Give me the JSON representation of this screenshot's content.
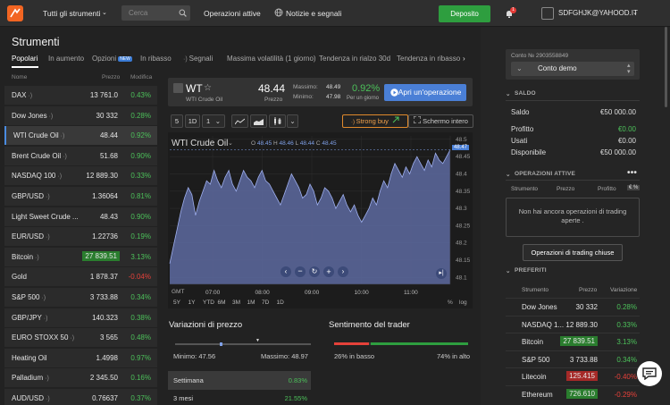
{
  "topbar": {
    "all_instruments": "Tutti gli strumenti",
    "search_placeholder": "Cerca",
    "active_ops": "Operazioni attive",
    "news": "Notizie e segnali",
    "deposit": "Deposito",
    "notif_count": "1",
    "user": "SDFGHJK@YAHOOD.IT"
  },
  "left": {
    "heading": "Strumenti",
    "tabs": [
      "Popolari",
      "In aumento",
      "Opzioni",
      "In ribasso",
      "Segnali",
      "Massima volatilità (1 giorno)",
      "Tendenza in rialzo 30d",
      "Tendenza in ribasso"
    ],
    "new_badge": "NEW",
    "list_headers": {
      "name": "Nome",
      "price": "Prezzo",
      "change": "Modifica"
    },
    "instruments": [
      {
        "name": "DAX",
        "sig": "·)",
        "price": "13 761.0",
        "change": "0.43%",
        "dir": "up"
      },
      {
        "name": "Dow Jones",
        "sig": "·)",
        "price": "30 332",
        "change": "0.28%",
        "dir": "up"
      },
      {
        "name": "WTI Crude Oil",
        "sig": "·)",
        "price": "48.44",
        "change": "0.92%",
        "dir": "up",
        "selected": true
      },
      {
        "name": "Brent Crude Oil",
        "sig": "·)",
        "price": "51.68",
        "change": "0.90%",
        "dir": "up"
      },
      {
        "name": "NASDAQ 100",
        "sig": "·)",
        "price": "12 889.30",
        "change": "0.33%",
        "dir": "up"
      },
      {
        "name": "GBP/USD",
        "sig": "·)",
        "price": "1.36064",
        "change": "0.81%",
        "dir": "up"
      },
      {
        "name": "Light Sweet Crude ...",
        "sig": "",
        "price": "48.43",
        "change": "0.90%",
        "dir": "up"
      },
      {
        "name": "EUR/USD",
        "sig": "·)",
        "price": "1.22736",
        "change": "0.19%",
        "dir": "up"
      },
      {
        "name": "Bitcoin",
        "sig": "·)",
        "price": "27 839.51",
        "change": "3.13%",
        "dir": "up",
        "highlight": true
      },
      {
        "name": "Gold",
        "sig": "",
        "price": "1 878.37",
        "change": "-0.04%",
        "dir": "dn"
      },
      {
        "name": "S&P 500",
        "sig": "·)",
        "price": "3 733.88",
        "change": "0.34%",
        "dir": "up"
      },
      {
        "name": "GBP/JPY",
        "sig": "·)",
        "price": "140.323",
        "change": "0.38%",
        "dir": "up"
      },
      {
        "name": "EURO STOXX 50",
        "sig": "·)",
        "price": "3 565",
        "change": "0.48%",
        "dir": "up"
      },
      {
        "name": "Heating Oil",
        "sig": "",
        "price": "1.4998",
        "change": "0.97%",
        "dir": "up"
      },
      {
        "name": "Palladium",
        "sig": "·)",
        "price": "2 345.50",
        "change": "0.16%",
        "dir": "up"
      },
      {
        "name": "AUD/USD",
        "sig": "·)",
        "price": "0.76637",
        "change": "0.37%",
        "dir": "up"
      }
    ]
  },
  "card": {
    "symbol": "WT",
    "star": "☆",
    "name": "WTI Crude Oil",
    "price": "48.44",
    "price_label": "Prezzo",
    "max_label": "Massimo:",
    "max": "48.49",
    "min_label": "Minimo:",
    "min": "47.98",
    "change": "0.92%",
    "change_label": "Per un giorno",
    "open_trade": "Apri un'operazione"
  },
  "toolbar": {
    "qty": "5",
    "timeframe": "1D",
    "count": "1",
    "strong_buy": "Strong buy",
    "fullscreen": "Schermo intero"
  },
  "chart": {
    "title": "WTI Crude Oil",
    "ohlc": {
      "o_label": "O",
      "o": "48.45",
      "h_label": "H",
      "h": "48.46",
      "l_label": "L",
      "l": "48.44",
      "c_label": "C",
      "c": "48.45"
    },
    "last_price": "48.47",
    "bottom_left": "GMT",
    "periods": [
      "5Y",
      "1Y",
      "YTD",
      "6M",
      "3M",
      "1M",
      "7D",
      "1D"
    ],
    "pct": "%",
    "log": "log"
  },
  "chart_data": {
    "type": "area",
    "title": "WTI Crude Oil",
    "xlabel": "",
    "ylabel": "",
    "x_ticks": [
      "07:00",
      "08:00",
      "09:00",
      "10:00",
      "11:00"
    ],
    "y_ticks": [
      48.5,
      48.45,
      48.4,
      48.35,
      48.3,
      48.25,
      48.2,
      48.15,
      48.1
    ],
    "ylim": [
      48.08,
      48.51
    ],
    "grid": true,
    "series": [
      {
        "values": [
          48.14,
          48.19,
          48.24,
          48.29,
          48.33,
          48.36,
          48.34,
          48.28,
          48.32,
          48.35,
          48.38,
          48.37,
          48.41,
          48.38,
          48.36,
          48.39,
          48.41,
          48.37,
          48.35,
          48.38,
          48.41,
          48.39,
          48.38,
          48.36,
          48.39,
          48.41,
          48.38,
          48.37,
          48.35,
          48.33,
          48.31,
          48.34,
          48.37,
          48.4,
          48.38,
          48.36,
          48.33,
          48.34,
          48.37,
          48.35,
          48.31,
          48.33,
          48.36,
          48.35,
          48.33,
          48.3,
          48.32,
          48.34,
          48.31,
          48.29,
          48.31,
          48.28,
          48.26,
          48.28,
          48.3,
          48.33,
          48.31,
          48.35,
          48.38,
          48.36,
          48.4,
          48.43,
          48.41,
          48.39,
          48.42,
          48.4,
          48.43,
          48.45,
          48.43,
          48.41,
          48.44,
          48.42,
          48.46,
          48.44,
          48.43,
          48.45,
          48.47
        ]
      }
    ]
  },
  "stats": {
    "price_var_title": "Variazioni di prezzo",
    "min_label": "Minimo:",
    "min": "47.56",
    "max_label": "Massimo:",
    "max": "48.97",
    "periods": [
      {
        "label": "Settimana",
        "value": "0.83%"
      },
      {
        "label": "3 mesi",
        "value": "21.55%"
      }
    ],
    "sentiment_title": "Sentimento del trader",
    "sell_pct": 26,
    "buy_pct": 74,
    "sell_label": "26% in basso",
    "buy_label": "74% in alto"
  },
  "account": {
    "number_label": "Conto № 2903558849",
    "type": "Conto demo"
  },
  "saldo": {
    "title": "SALDO",
    "rows": [
      {
        "k": "Saldo",
        "v": "€50 000.00"
      },
      {
        "k": "Profitto",
        "v": "€0.00"
      },
      {
        "k": "Usati",
        "v": "€0.00"
      },
      {
        "k": "Disponibile",
        "v": "€50 000.00"
      }
    ]
  },
  "active": {
    "title": "OPERAZIONI ATTIVE",
    "col_instrument": "Strumento",
    "col_price": "Prezzo",
    "col_profit": "Profitto",
    "empty": "Non hai ancora operazioni di trading aperte .",
    "closed_button": "Operazioni di trading chiuse"
  },
  "favorites": {
    "title": "PREFERITI",
    "col_instrument": "Strumento",
    "col_price": "Prezzo",
    "col_change": "Variazione",
    "rows": [
      {
        "name": "Dow Jones",
        "price": "30 332",
        "change": "0.28%",
        "dir": "up",
        "bg": ""
      },
      {
        "name": "NASDAQ 1...",
        "price": "12 889.30",
        "change": "0.33%",
        "dir": "up",
        "bg": ""
      },
      {
        "name": "Bitcoin",
        "price": "27 839.51",
        "change": "3.13%",
        "dir": "up",
        "bg": "up"
      },
      {
        "name": "S&P 500",
        "price": "3 733.88",
        "change": "0.34%",
        "dir": "up",
        "bg": ""
      },
      {
        "name": "Litecoin",
        "price": "125.415",
        "change": "-0.40%",
        "dir": "dn",
        "bg": "dn"
      },
      {
        "name": "Ethereum",
        "price": "726.610",
        "change": "-0.29%",
        "dir": "dn",
        "bg": "up"
      }
    ]
  },
  "colors": {
    "up": "#4cc05a",
    "down": "#e5413a",
    "accent": "#4a7fd6",
    "brand": "#f26522",
    "area": "#5a6699"
  }
}
